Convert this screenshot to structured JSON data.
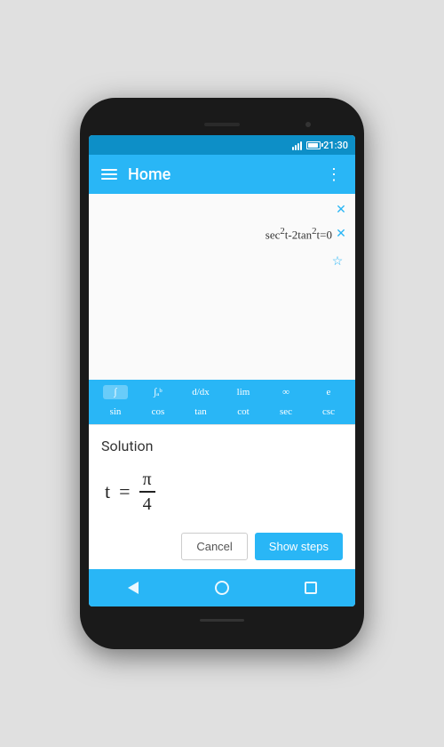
{
  "status_bar": {
    "time": "21:30"
  },
  "app_bar": {
    "title": "Home",
    "menu_icon": "menu-icon",
    "more_icon": "more-icon"
  },
  "equations": [
    {
      "id": 1,
      "display": "",
      "has_x": true,
      "has_star": false
    },
    {
      "id": 2,
      "display": "sec²t-2tan²t=0",
      "has_x": true,
      "has_star": false
    },
    {
      "id": 3,
      "display": "",
      "has_x": false,
      "has_star": true
    }
  ],
  "math_toolbar": {
    "row1": [
      "∫",
      "∫ₐᵇ",
      "d/dx",
      "lim",
      "∞",
      "e"
    ],
    "row2": [
      "sin",
      "cos",
      "tan",
      "cot",
      "sec",
      "csc"
    ]
  },
  "solution": {
    "title": "Solution",
    "variable": "t",
    "equals": "=",
    "numerator": "π",
    "denominator": "4"
  },
  "buttons": {
    "cancel": "Cancel",
    "show_steps": "Show steps"
  },
  "nav": {
    "back": "back",
    "home": "home",
    "recent": "recent"
  },
  "colors": {
    "primary": "#29b6f6",
    "dark_primary": "#0d8fc7",
    "white": "#ffffff",
    "text_dark": "#333333",
    "background": "#fafafa"
  }
}
